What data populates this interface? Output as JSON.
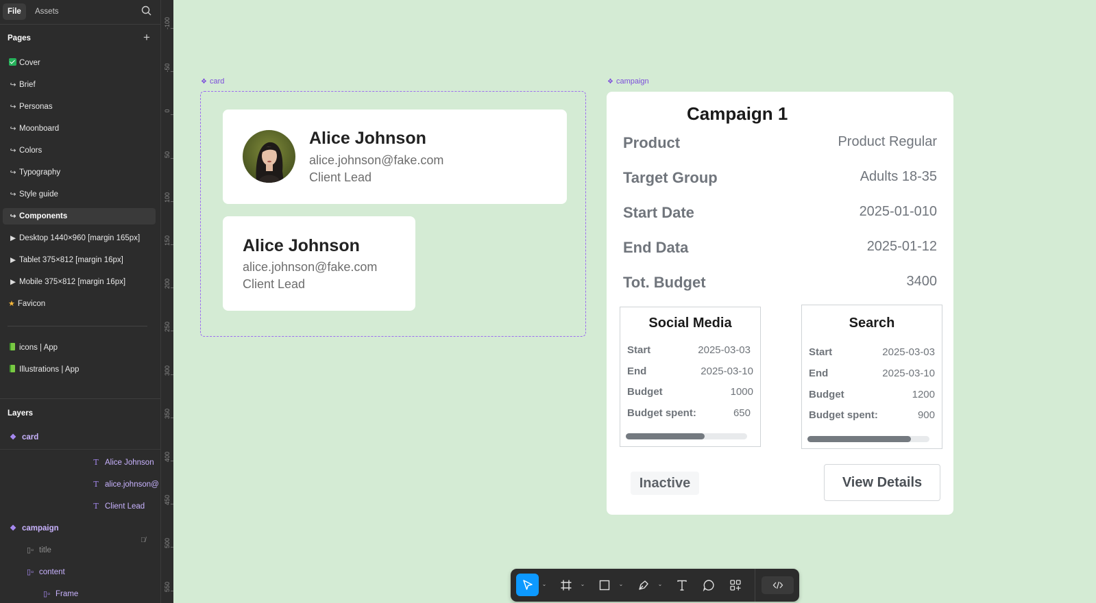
{
  "sidebar": {
    "tabs": [
      "File",
      "Assets"
    ],
    "pages_title": "Pages",
    "pages": [
      {
        "label": "Cover",
        "icon": "checkbox-icon"
      },
      {
        "label": "Brief",
        "icon": "link-arrow-icon"
      },
      {
        "label": "Personas",
        "icon": "link-arrow-icon"
      },
      {
        "label": "Moonboard",
        "icon": "link-arrow-icon"
      },
      {
        "label": "Colors",
        "icon": "link-arrow-icon"
      },
      {
        "label": "Typography",
        "icon": "link-arrow-icon"
      },
      {
        "label": "Style guide",
        "icon": "link-arrow-icon"
      },
      {
        "label": "Components",
        "icon": "link-arrow-icon",
        "selected": true
      },
      {
        "label": "Desktop 1440×960 [margin 165px]",
        "icon": "play-icon"
      },
      {
        "label": "Tablet 375×812 [margin 16px]",
        "icon": "play-icon"
      },
      {
        "label": "Mobile 375×812 [margin 16px]",
        "icon": "play-icon"
      },
      {
        "label": "Favicon",
        "icon": "star-icon"
      }
    ],
    "libraries": [
      {
        "label": "icons | App"
      },
      {
        "label": "Illustrations | App"
      }
    ],
    "layers_title": "Layers",
    "layers": {
      "card": "card",
      "card_children": [
        "Alice Johnson",
        "alice.johnson@",
        "Client Lead"
      ],
      "campaign": "campaign",
      "campaign_children": [
        "title",
        "content"
      ],
      "content_children": [
        "Frame"
      ]
    }
  },
  "ruler": {
    "ticks": [
      "-100",
      "-50",
      "0",
      "50",
      "100",
      "150",
      "200",
      "250",
      "300",
      "350",
      "400",
      "450",
      "500",
      "550"
    ]
  },
  "canvas": {
    "card_label": "card",
    "campaign_label": "campaign",
    "card_large": {
      "name": "Alice Johnson",
      "email": "alice.johnson@fake.com",
      "role": "Client Lead"
    },
    "card_small": {
      "name": "Alice Johnson",
      "email": "alice.johnson@fake.com",
      "role": "Client Lead"
    },
    "campaign": {
      "title": "Campaign 1",
      "rows": [
        {
          "label": "Product",
          "value": "Product Regular"
        },
        {
          "label": "Target Group",
          "value": "Adults 18-35"
        },
        {
          "label": "Start Date",
          "value": "2025-01-010"
        },
        {
          "label": "End Data",
          "value": "2025-01-12"
        },
        {
          "label": "Tot. Budget",
          "value": "3400"
        }
      ],
      "channels": [
        {
          "title": "Social Media",
          "rows": [
            {
              "label": "Start",
              "value": "2025-03-03"
            },
            {
              "label": "End",
              "value": "2025-03-10"
            },
            {
              "label": "Budget",
              "value": "1000"
            },
            {
              "label": "Budget spent:",
              "value": "650"
            }
          ],
          "progress": 0.65
        },
        {
          "title": "Search",
          "rows": [
            {
              "label": "Start",
              "value": "2025-03-03"
            },
            {
              "label": "End",
              "value": "2025-03-10"
            },
            {
              "label": "Budget",
              "value": "1200"
            },
            {
              "label": "Budget spent:",
              "value": "900"
            }
          ],
          "progress": 0.85
        }
      ],
      "status": "Inactive",
      "action": "View Details"
    }
  },
  "toolbar": {
    "tools": [
      "move-tool-icon",
      "frame-tool-icon",
      "rectangle-tool-icon",
      "pen-tool-icon",
      "text-tool-icon",
      "comment-tool-icon",
      "components-tool-icon",
      "code-icon"
    ]
  },
  "colors": {
    "canvas_bg": "#d4ebd4",
    "sidebar_bg": "#2c2c2c",
    "component_purple": "#9b6bf0",
    "accent_blue": "#0d99ff"
  }
}
